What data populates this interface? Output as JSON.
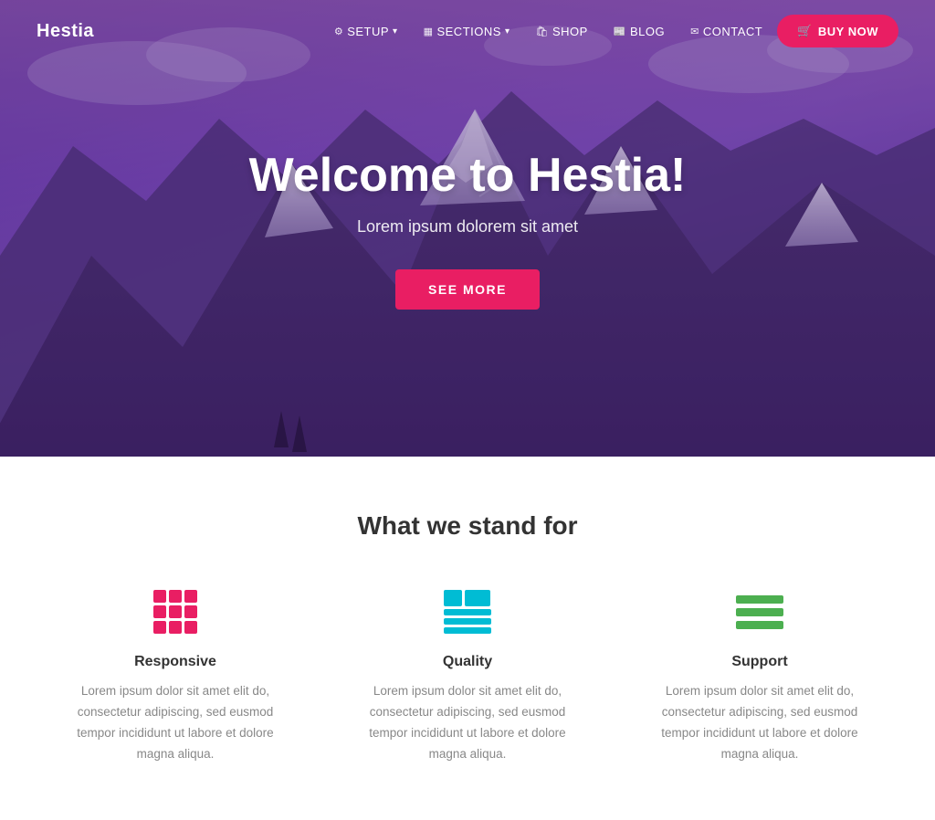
{
  "navbar": {
    "brand": "Hestia",
    "items": [
      {
        "label": "SETUP",
        "icon": "⚙",
        "hasDropdown": true
      },
      {
        "label": "SECTIONS",
        "icon": "▦",
        "hasDropdown": true
      },
      {
        "label": "SHOP",
        "icon": "🛍",
        "hasDropdown": false
      },
      {
        "label": "BLOG",
        "icon": "📰",
        "hasDropdown": false
      },
      {
        "label": "CONTACT",
        "icon": "✉",
        "hasDropdown": false
      }
    ],
    "buy_now_label": "BUY NOW",
    "cart_icon": "🛒"
  },
  "hero": {
    "title": "Welcome to Hestia!",
    "subtitle": "Lorem ipsum dolorem sit amet",
    "cta_label": "SEE MORE"
  },
  "features": {
    "section_title": "What we stand for",
    "items": [
      {
        "name": "Responsive",
        "icon_type": "grid",
        "description": "Lorem ipsum dolor sit amet elit do, consectetur adipiscing, sed eusmod tempor incididunt ut labore et dolore magna aliqua."
      },
      {
        "name": "Quality",
        "icon_type": "table",
        "description": "Lorem ipsum dolor sit amet elit do, consectetur adipiscing, sed eusmod tempor incididunt ut labore et dolore magna aliqua."
      },
      {
        "name": "Support",
        "icon_type": "lines",
        "description": "Lorem ipsum dolor sit amet elit do, consectetur adipiscing, sed eusmod tempor incididunt ut labore et dolore magna aliqua."
      }
    ]
  }
}
